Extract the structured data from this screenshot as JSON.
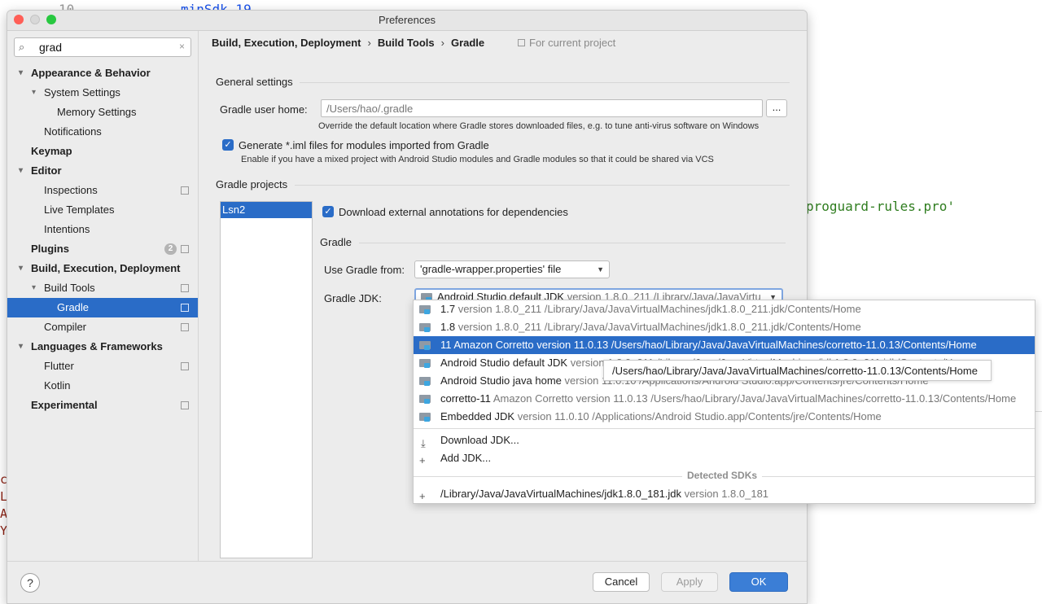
{
  "background": {
    "code_line_1": "minSdk 19",
    "code_line_1_num": "10",
    "code_line_2": "proguard-rules.pro'",
    "side_chars": [
      "c",
      "L",
      "A",
      "Y"
    ]
  },
  "window": {
    "title": "Preferences"
  },
  "search": {
    "value": "grad",
    "icon": "search-icon",
    "clear": "×"
  },
  "sidebar": {
    "items": [
      {
        "label": "Appearance & Behavior"
      },
      {
        "label": "System Settings"
      },
      {
        "label": "Memory Settings"
      },
      {
        "label": "Notifications"
      },
      {
        "label": "Keymap"
      },
      {
        "label": "Editor"
      },
      {
        "label": "Inspections"
      },
      {
        "label": "Live Templates"
      },
      {
        "label": "Intentions"
      },
      {
        "label": "Plugins",
        "badge": "2"
      },
      {
        "label": "Build, Execution, Deployment"
      },
      {
        "label": "Build Tools"
      },
      {
        "label": "Gradle"
      },
      {
        "label": "Compiler"
      },
      {
        "label": "Languages & Frameworks"
      },
      {
        "label": "Flutter"
      },
      {
        "label": "Kotlin"
      },
      {
        "label": "Experimental"
      }
    ]
  },
  "breadcrumb": {
    "items": [
      "Build, Execution, Deployment",
      "Build Tools",
      "Gradle"
    ],
    "separator": "›",
    "scope_hint": "For current project"
  },
  "general": {
    "section_title": "General settings",
    "user_home_label": "Gradle user home:",
    "user_home_value": "/Users/hao/.gradle",
    "browse_label": "...",
    "user_home_hint": "Override the default location where Gradle stores downloaded files, e.g. to tune anti-virus software on Windows",
    "generate_iml_label": "Generate *.iml files for modules imported from Gradle",
    "generate_iml_hint": "Enable if you have a mixed project with Android Studio modules and Gradle modules so that it could be shared via VCS"
  },
  "projects": {
    "section_title": "Gradle projects",
    "items": [
      "Lsn2"
    ],
    "download_annotations_label": "Download external annotations for dependencies",
    "gradle_section_title": "Gradle",
    "use_gradle_from_label": "Use Gradle from:",
    "use_gradle_from_value": "'gradle-wrapper.properties' file",
    "gradle_jdk_label": "Gradle JDK:",
    "gradle_jdk_value_name": "Android Studio default JDK",
    "gradle_jdk_value_detail": "version 1.8.0_211 /Library/Java/JavaVirtu"
  },
  "jdk_popup": {
    "options": [
      {
        "name": "1.7",
        "detail": "version 1.8.0_211 /Library/Java/JavaVirtualMachines/jdk1.8.0_211.jdk/Contents/Home"
      },
      {
        "name": "1.8",
        "detail": "version 1.8.0_211 /Library/Java/JavaVirtualMachines/jdk1.8.0_211.jdk/Contents/Home"
      },
      {
        "name": "11 Amazon Corretto version 11.0.13 /Users/hao/Library/Java/JavaVirtualMachines/corretto-11.0.13/Contents/Home",
        "detail": ""
      },
      {
        "name": "Android Studio default JDK",
        "detail": "version 1.8.0_211 /Library/Java/JavaVirtualMachines/jdk1.8.0_211.jdk/Contents/Home"
      },
      {
        "name": "Android Studio java home",
        "detail": "version 11.0.10 /Applications/Android Studio.app/Contents/jre/Contents/Home"
      },
      {
        "name": "corretto-11",
        "detail": "Amazon Corretto version 11.0.13 /Users/hao/Library/Java/JavaVirtualMachines/corretto-11.0.13/Contents/Home"
      },
      {
        "name": "Embedded JDK",
        "detail": "version 11.0.10 /Applications/Android Studio.app/Contents/jre/Contents/Home"
      }
    ],
    "download_jdk": "Download JDK...",
    "add_jdk": "Add JDK...",
    "detected_header": "Detected SDKs",
    "detected": [
      {
        "name": "/Library/Java/JavaVirtualMachines/jdk1.8.0_181.jdk",
        "detail": "version 1.8.0_181"
      }
    ],
    "tooltip": "/Users/hao/Library/Java/JavaVirtualMachines/corretto-11.0.13/Contents/Home"
  },
  "footer": {
    "help": "?",
    "cancel": "Cancel",
    "apply": "Apply",
    "ok": "OK"
  },
  "colors": {
    "accent": "#2a6cc7",
    "ok_button": "#3b7ed6",
    "window_bg": "#ececec",
    "close": "#ff5f57",
    "minimize": "#febc2e",
    "zoom": "#28c840"
  }
}
